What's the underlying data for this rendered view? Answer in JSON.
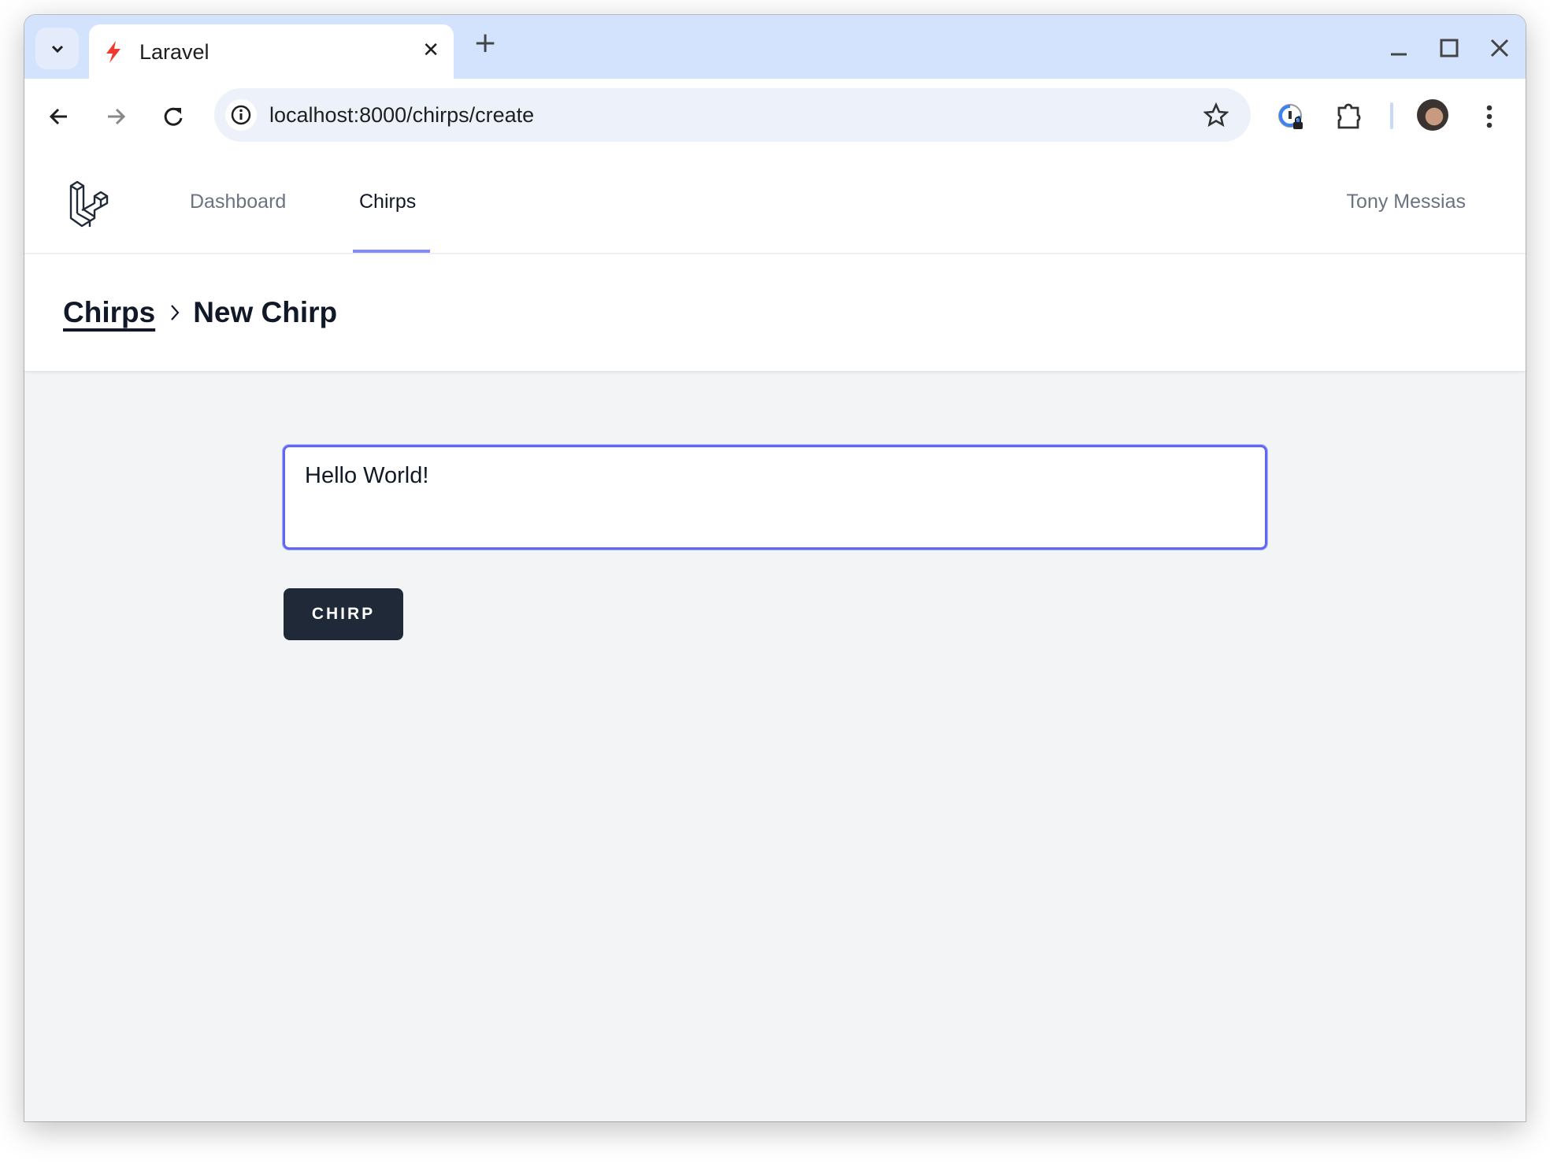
{
  "browser": {
    "tab_title": "Laravel",
    "url": "localhost:8000/chirps/create",
    "icons": [
      "chevron-down-icon",
      "laravel-favicon",
      "close-icon",
      "plus-icon",
      "minimize-icon",
      "maximize-icon",
      "close-window-icon",
      "back-icon",
      "forward-icon",
      "reload-icon",
      "info-icon",
      "star-icon",
      "password-manager-icon",
      "extensions-icon",
      "avatar",
      "more-vert-icon"
    ]
  },
  "nav": {
    "items": [
      {
        "label": "Dashboard",
        "active": false
      },
      {
        "label": "Chirps",
        "active": true
      }
    ],
    "user": "Tony Messias",
    "accent": "#818cf8"
  },
  "header": {
    "breadcrumb_parent": "Chirps",
    "separator": ">",
    "title": "New Chirp"
  },
  "form": {
    "message": "Hello World!",
    "submit_label": "CHIRP",
    "focus_color": "#6366f1",
    "button_color": "#1f2937"
  }
}
